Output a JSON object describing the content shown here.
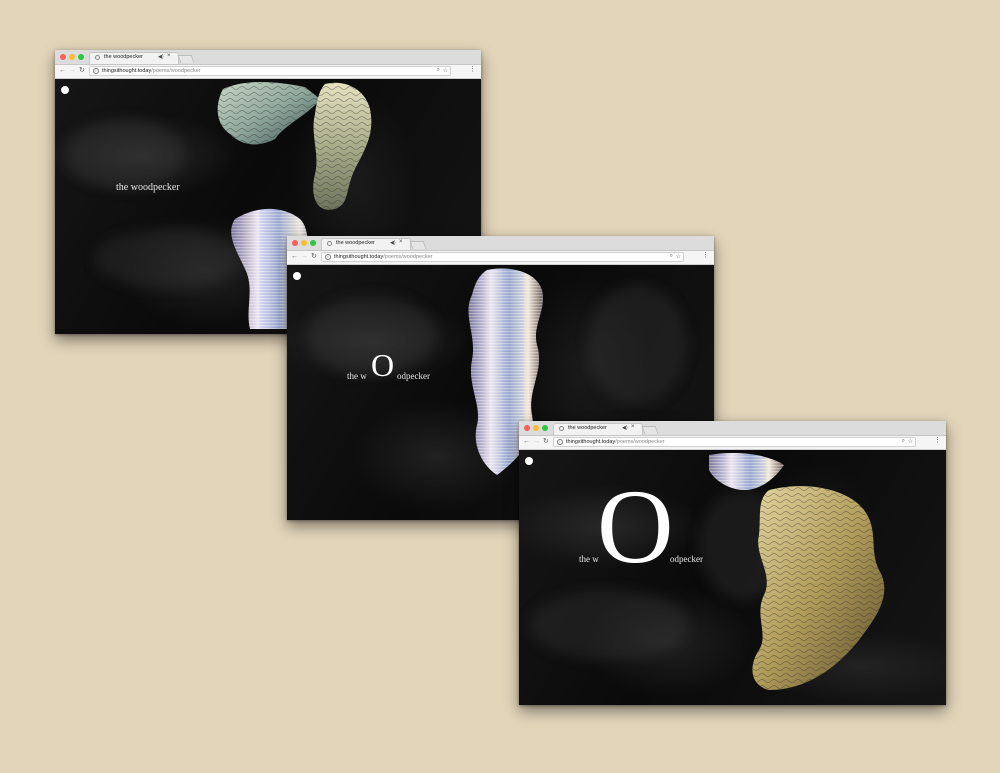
{
  "colors": {
    "backdrop": "#e3d5ba",
    "page_background": "#0b0b0b",
    "title_text": "#e8e8e8"
  },
  "windows": [
    {
      "tab_title": "the woodpecker",
      "url_host": "thingsithought.today",
      "url_path": "/poems/woodpecker",
      "title_text": "the woodpecker"
    },
    {
      "tab_title": "the woodpecker",
      "url_host": "thingsithought.today",
      "url_path": "/poems/woodpecker",
      "title_pre": "the w",
      "title_big": "O",
      "title_post": "odpecker"
    },
    {
      "tab_title": "the woodpecker",
      "url_host": "thingsithought.today",
      "url_path": "/poems/woodpecker",
      "title_pre": "the w",
      "title_big": "O",
      "title_post": "odpecker"
    }
  ],
  "icons": {
    "info": "info-icon",
    "zoom": "zoom-icon",
    "star": "bookmark-star-icon",
    "menu": "menu-dots-icon",
    "back": "back-arrow-icon",
    "forward": "forward-arrow-icon",
    "reload": "reload-icon",
    "audio": "speaker-icon",
    "close": "close-icon"
  }
}
